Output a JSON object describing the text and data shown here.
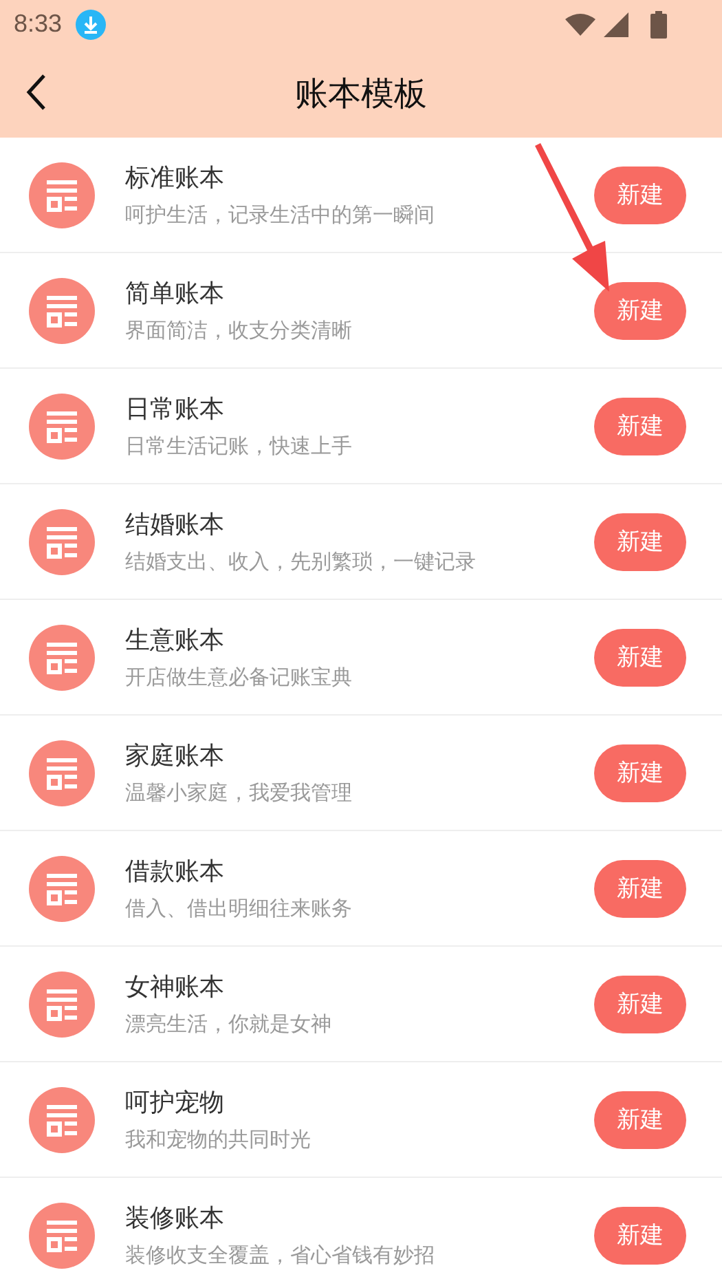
{
  "status_bar": {
    "time": "8:33"
  },
  "header": {
    "title": "账本模板"
  },
  "templates": [
    {
      "name": "标准账本",
      "description": "呵护生活，记录生活中的第一瞬间",
      "button": "新建"
    },
    {
      "name": "简单账本",
      "description": "界面简洁，收支分类清晰",
      "button": "新建"
    },
    {
      "name": "日常账本",
      "description": "日常生活记账，快速上手",
      "button": "新建"
    },
    {
      "name": "结婚账本",
      "description": "结婚支出、收入，先别繁琐，一键记录",
      "button": "新建"
    },
    {
      "name": "生意账本",
      "description": "开店做生意必备记账宝典",
      "button": "新建"
    },
    {
      "name": "家庭账本",
      "description": "温馨小家庭，我爱我管理",
      "button": "新建"
    },
    {
      "name": "借款账本",
      "description": "借入、借出明细往来账务",
      "button": "新建"
    },
    {
      "name": "女神账本",
      "description": "漂亮生活，你就是女神",
      "button": "新建"
    },
    {
      "name": "呵护宠物",
      "description": "我和宠物的共同时光",
      "button": "新建"
    },
    {
      "name": "装修账本",
      "description": "装修收支全覆盖，省心省钱有妙招",
      "button": "新建"
    }
  ]
}
